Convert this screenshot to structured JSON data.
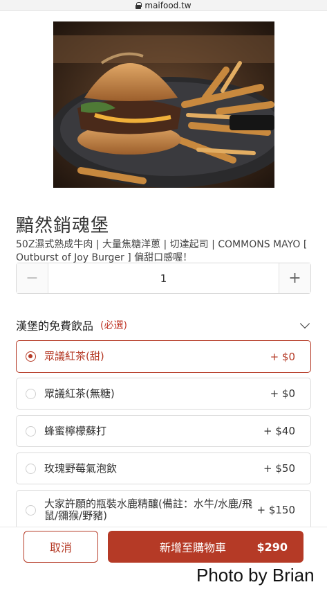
{
  "browser": {
    "url": "maifood.tw"
  },
  "product": {
    "name": "黯然銷魂堡",
    "description": "50Z濕式熟成牛肉 | 大量焦糖洋蔥 | 切達起司 | COMMONS MAYO [ Outburst of Joy Burger ] 偏甜口感喔！",
    "quantity": "1",
    "minus_symbol": "−",
    "plus_symbol": "+"
  },
  "drink_section": {
    "title": "漢堡的免費飲品",
    "required": "(必選)",
    "options": [
      {
        "label": "眾議紅茶(甜)",
        "price": "+ $0",
        "selected": true
      },
      {
        "label": "眾議紅茶(無糖)",
        "price": "+ $0",
        "selected": false
      },
      {
        "label": "蜂蜜檸檬蘇打",
        "price": "+ $40",
        "selected": false
      },
      {
        "label": "玫瑰野莓氣泡飲",
        "price": "+ $50",
        "selected": false
      },
      {
        "label": "大家許願的瓶裝水鹿精釀(備註：水牛/水鹿/飛鼠/獼猴/野豬)",
        "price": "+ $150",
        "selected": false
      }
    ]
  },
  "footer": {
    "cancel_label": "取消",
    "add_label": "新增至購物車",
    "total": "$290"
  },
  "watermark": "Photo by Brian",
  "colors": {
    "accent": "#b53a26"
  }
}
